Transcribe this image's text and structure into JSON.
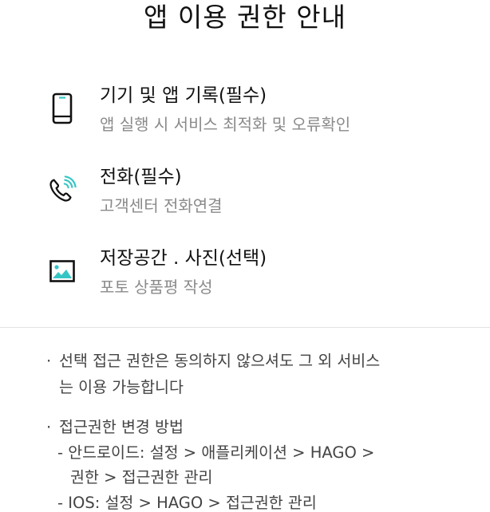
{
  "title": "앱 이용 권한 안내",
  "permissions": [
    {
      "icon": "smartphone-icon",
      "name": "기기 및 앱 기록(필수)",
      "desc": "앱 실행 시 서비스 최적화 및 오류확인"
    },
    {
      "icon": "phone-call-icon",
      "name": "전화(필수)",
      "desc": "고객센터 전화연결"
    },
    {
      "icon": "image-icon",
      "name": "저장공간 . 사진(선택)",
      "desc": "포토 상품평 작성"
    }
  ],
  "notes": {
    "bullet": "·",
    "optional_line1": "선택 접근 권한은 동의하지 않으셔도 그 외 서비스",
    "optional_line2": "는 이용 가능합니다",
    "change_title": "접근권한 변경 방법",
    "android_line1": "- 안드로이드: 설정 > 애플리케이션 > HAGO >",
    "android_line2": "권한 > 접근권한 관리",
    "ios_line": "- IOS: 설정 > HAGO > 접근권한 관리"
  },
  "colors": {
    "text_primary": "#111111",
    "text_secondary": "#8a8a8a",
    "icon_accent": "#36c5c5"
  }
}
